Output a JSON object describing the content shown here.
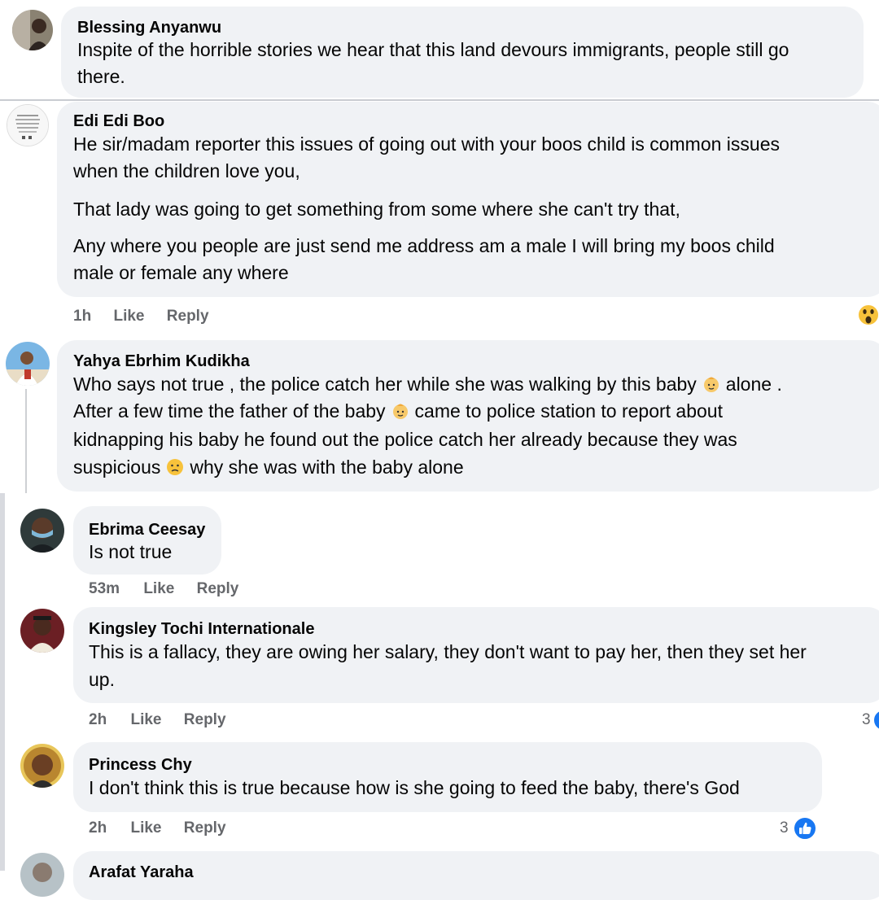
{
  "comments": [
    {
      "author": "Blessing Anyanwu",
      "lines": [
        "Inspite of the horrible stories we hear that this land devours immigrants, people still go",
        "there."
      ]
    },
    {
      "author": "Edi Edi Boo",
      "lines": [
        "He sir/madam reporter this issues of going out with your boos child is common issues",
        "when the children love you,",
        "That lady was going to get something from some where she can't try that,",
        "Any where you people are just send me address am a male I will bring my boos child",
        "male or female any where"
      ],
      "time": "1h",
      "like": "Like",
      "reply": "Reply",
      "reaction": "wow-emoji"
    },
    {
      "author": "Yahya Ebrhim Kudikha",
      "line1_a": "Who says not true , the police catch her while she was walking by this baby",
      "line1_b": "alone .",
      "line2_a": "After a few time the father of the baby",
      "line2_b": "came to police station to report about",
      "line3": "kidnapping his baby he found out the police catch her already because they was",
      "line4_a": "suspicious",
      "line4_b": "why she was with the baby alone",
      "emojis": [
        "baby-emoji",
        "baby-emoji",
        "worried-face-emoji"
      ]
    },
    {
      "author": "Ebrima Ceesay",
      "lines": [
        "Is not true"
      ],
      "time": "53m",
      "like": "Like",
      "reply": "Reply"
    },
    {
      "author": "Kingsley Tochi Internationale",
      "lines": [
        "This is a fallacy, they are owing her salary, they don't want to pay her, then they set her",
        "up."
      ],
      "time": "2h",
      "like": "Like",
      "reply": "Reply",
      "reaction_count": "3"
    },
    {
      "author": "Princess Chy",
      "lines": [
        "I don't think this is true because how is she going to feed the baby, there's God"
      ],
      "time": "2h",
      "like": "Like",
      "reply": "Reply",
      "reaction_count": "3",
      "reaction": "like-icon"
    },
    {
      "author": "Arafat Yaraha"
    }
  ],
  "colors": {
    "bubble": "#f0f2f5",
    "meta": "#65676b",
    "like_blue": "#1877f2"
  }
}
